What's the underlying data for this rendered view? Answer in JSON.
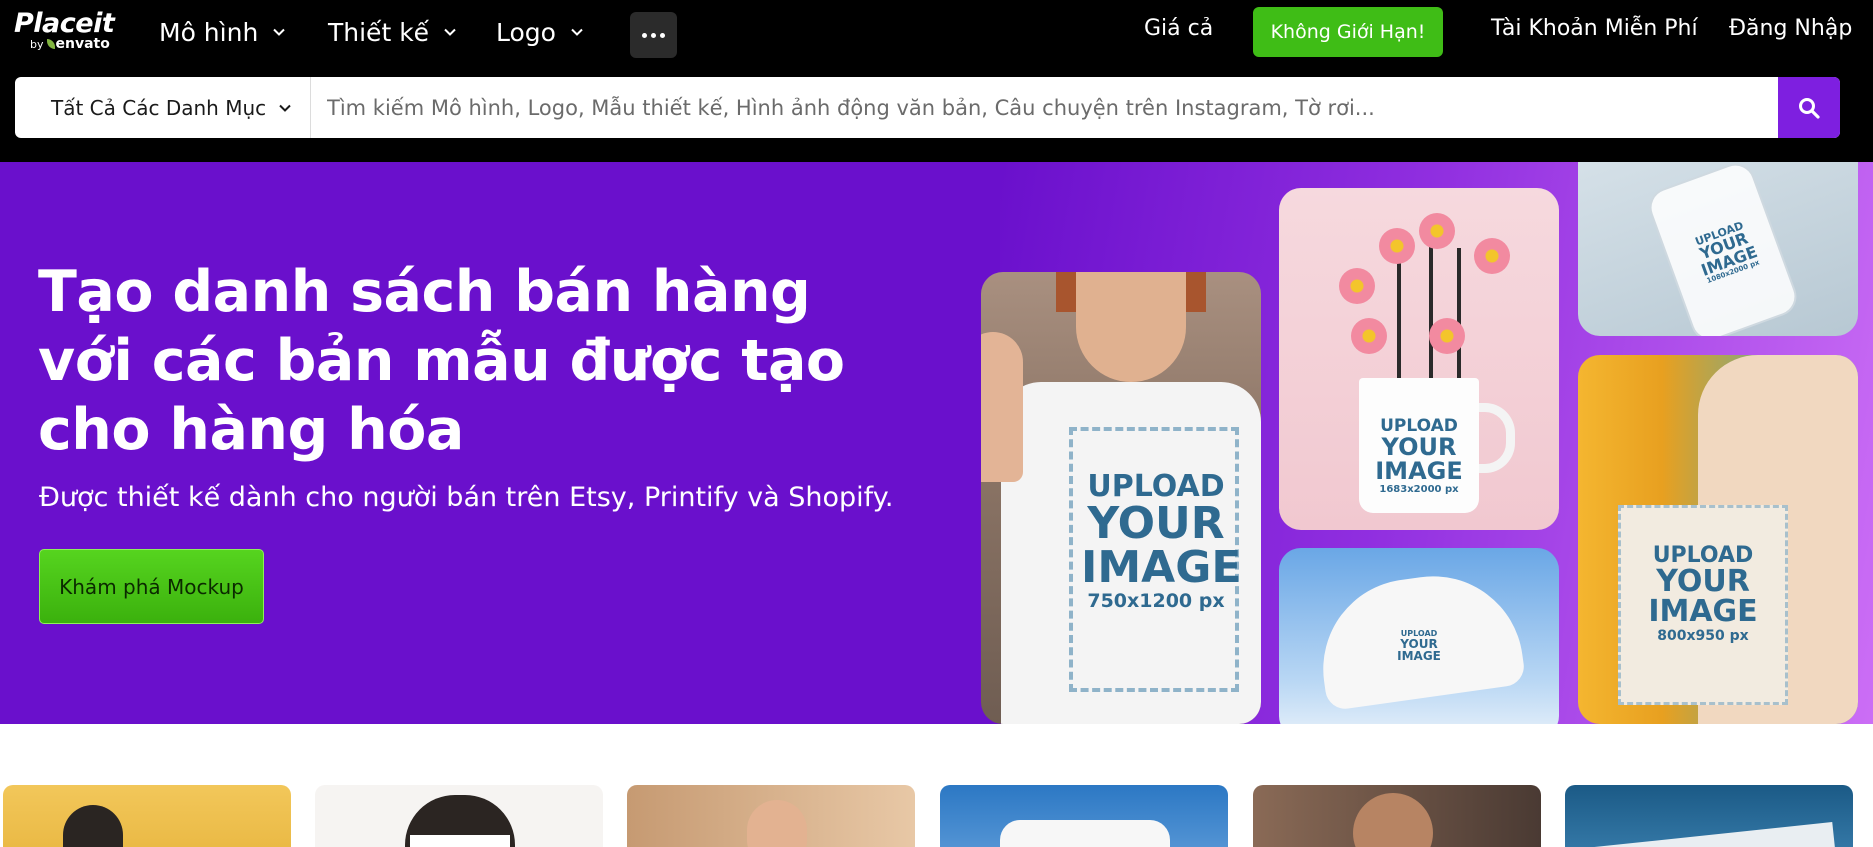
{
  "brand": {
    "logo_text": "Placeit",
    "by_prefix": "by",
    "by_name": "envato"
  },
  "nav": {
    "items": [
      {
        "label": "Mô hình"
      },
      {
        "label": "Thiết kế"
      },
      {
        "label": "Logo"
      }
    ],
    "pricing": "Giá cả",
    "unlimited": "Không Giới Hạn!",
    "free_account": "Tài Khoản Miễn Phí",
    "login": "Đăng Nhập"
  },
  "search": {
    "category": "Tất Cả Các Danh Mục",
    "placeholder": "Tìm kiếm Mô hình, Logo, Mẫu thiết kế, Hình ảnh động văn bản, Câu chuyện trên Instagram, Tờ rơi..."
  },
  "hero": {
    "title": "Tạo danh sách bán hàng với các bản mẫu được tạo cho hàng hóa",
    "subtitle": "Được thiết kế dành cho người bán trên Etsy, Printify và Shopify.",
    "cta": "Khám phá Mockup",
    "mockups": {
      "shirt": {
        "line1": "UPLOAD",
        "line2": "YOUR",
        "line3": "IMAGE",
        "size": "750x1200 px"
      },
      "mug": {
        "line1": "UPLOAD",
        "line2": "YOUR",
        "line3": "IMAGE",
        "size": "1683x2000 px"
      },
      "phone": {
        "line1": "UPLOAD",
        "line2": "YOUR",
        "line3": "IMAGE",
        "size": "1080x2000 px"
      },
      "cap": {
        "line1": "UPLOAD",
        "line2": "YOUR",
        "line3": "IMAGE"
      },
      "tote": {
        "line1": "UPLOAD",
        "line2": "YOUR",
        "line3": "IMAGE",
        "size": "800x950 px"
      }
    }
  },
  "colors": {
    "topbar": "#000000",
    "hero_bg": "#6a10cc",
    "accent_green": "#3fbd16",
    "search_button": "#7e1fe0"
  },
  "icons": {
    "search": "search-icon",
    "more": "more-dots-icon",
    "chevron": "chevron-down-icon"
  }
}
